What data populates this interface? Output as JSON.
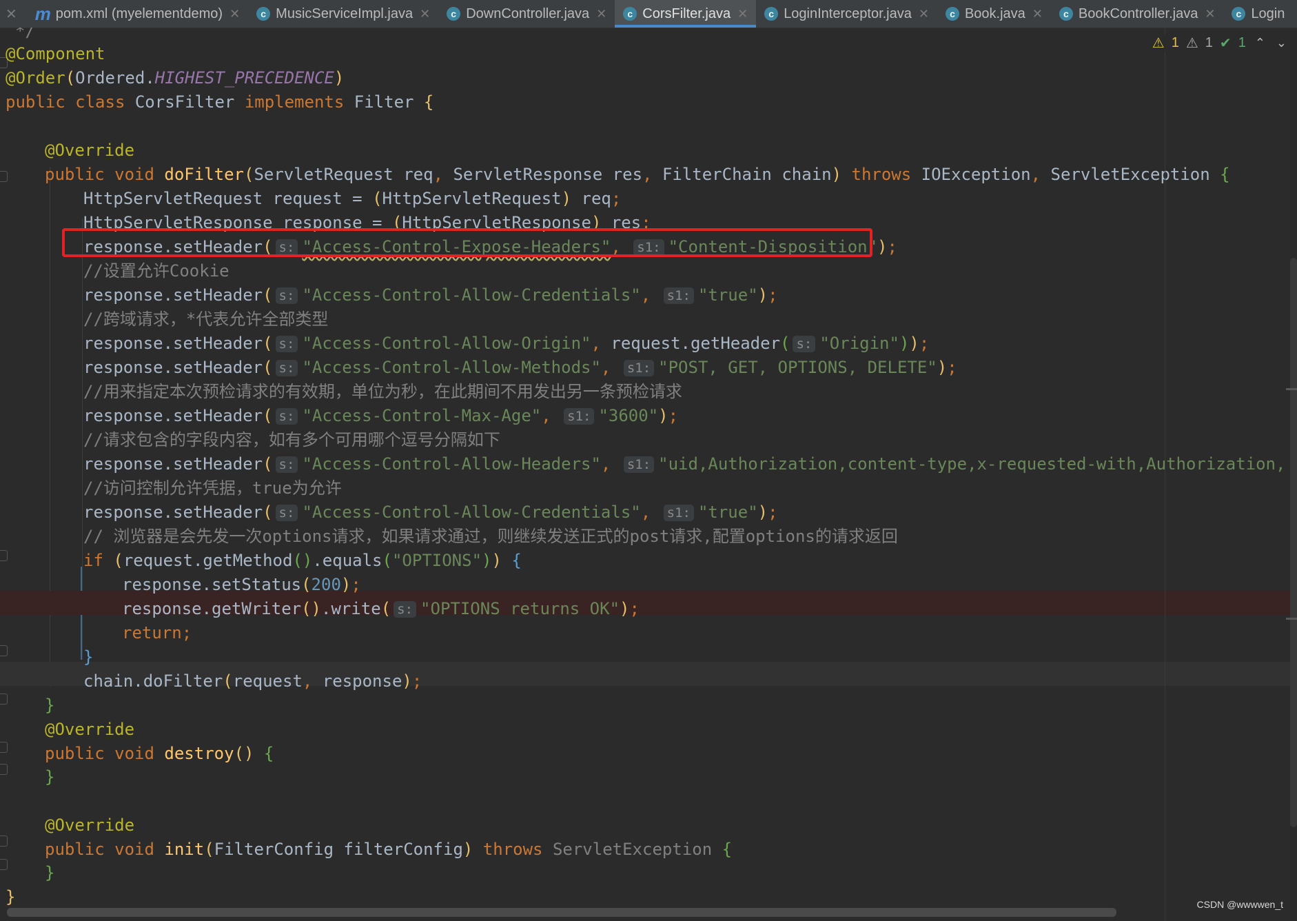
{
  "tabs": [
    {
      "icon": "m",
      "label": "pom.xml (myelementdemo)",
      "closable": true,
      "active": false
    },
    {
      "icon": "c",
      "label": "MusicServiceImpl.java",
      "closable": true,
      "active": false
    },
    {
      "icon": "c",
      "label": "DownController.java",
      "closable": true,
      "active": false
    },
    {
      "icon": "c",
      "label": "CorsFilter.java",
      "closable": true,
      "active": true
    },
    {
      "icon": "c",
      "label": "LoginInterceptor.java",
      "closable": true,
      "active": false
    },
    {
      "icon": "c",
      "label": "Book.java",
      "closable": true,
      "active": false
    },
    {
      "icon": "c",
      "label": "BookController.java",
      "closable": true,
      "active": false
    },
    {
      "icon": "c",
      "label": "Login",
      "closable": false,
      "active": false
    }
  ],
  "inspections": {
    "warnings_yellow": "1",
    "warnings_gray": "1",
    "ok": "1"
  },
  "code": {
    "l_comment_end": "*/",
    "ann_component": "@Component",
    "ann_order": "@Order",
    "ordered": "Ordered",
    "highest": "HIGHEST_PRECEDENCE",
    "kw_public": "public",
    "kw_class": "class",
    "class_name": "CorsFilter",
    "kw_implements": "implements",
    "filter": "Filter",
    "ann_override": "@Override",
    "kw_void": "void",
    "m_dofilter": "doFilter",
    "t_servlet_request": "ServletRequest",
    "p_req": "req",
    "t_servlet_response": "ServletResponse",
    "p_res": "res",
    "t_filter_chain": "FilterChain",
    "p_chain": "chain",
    "kw_throws": "throws",
    "ioexception": "IOException",
    "servletexception": "ServletException",
    "t_http_req": "HttpServletRequest",
    "v_request": "request",
    "t_http_res": "HttpServletResponse",
    "v_response": "response",
    "set_header": "response.setHeader",
    "hint_s": "s:",
    "hint_s1": "s1:",
    "s_expose": "\"Access-Control-Expose-Headers\"",
    "s_content_disp": "\"Content-Disposition\"",
    "c_cookie": "//设置允许Cookie",
    "s_allow_cred": "\"Access-Control-Allow-Credentials\"",
    "s_true": "\"true\"",
    "c_cross": "//跨域请求，*代表允许全部类型",
    "s_allow_origin": "\"Access-Control-Allow-Origin\"",
    "req_get_header": "request.getHeader",
    "s_origin": "\"Origin\"",
    "s_allow_methods": "\"Access-Control-Allow-Methods\"",
    "s_methods": "\"POST, GET, OPTIONS, DELETE\"",
    "c_max_age": "//用来指定本次预检请求的有效期，单位为秒，在此期间不用发出另一条预检请求",
    "s_max_age": "\"Access-Control-Max-Age\"",
    "s_3600": "\"3600\"",
    "c_headers": "//请求包含的字段内容，如有多个可用哪个逗号分隔如下",
    "s_allow_headers": "\"Access-Control-Allow-Headers\"",
    "s_headers_val": "\"uid,Authorization,content-type,x-requested-with,Authorization, x-ui-request,authen",
    "c_cred": "//访问控制允许凭据，true为允许",
    "c_browser": "// 浏览器是会先发一次options请求，如果请求通过，则继续发送正式的post请求,配置options的请求返回",
    "kw_if": "if",
    "req_get_method": "request.getMethod",
    "equals": ".equals",
    "s_options": "\"OPTIONS\"",
    "set_status": "response.setStatus",
    "n_200": "200",
    "get_writer": "response.getWriter",
    "write": ".write",
    "s_options_ok": "\"OPTIONS returns OK\"",
    "kw_return": "return",
    "chain_dofilter": "chain.doFilter",
    "m_destroy": "destroy",
    "m_init": "init",
    "t_filter_config": "FilterConfig",
    "p_filter_config": "filterConfig"
  },
  "watermark": "CSDN @wwwwen_t"
}
